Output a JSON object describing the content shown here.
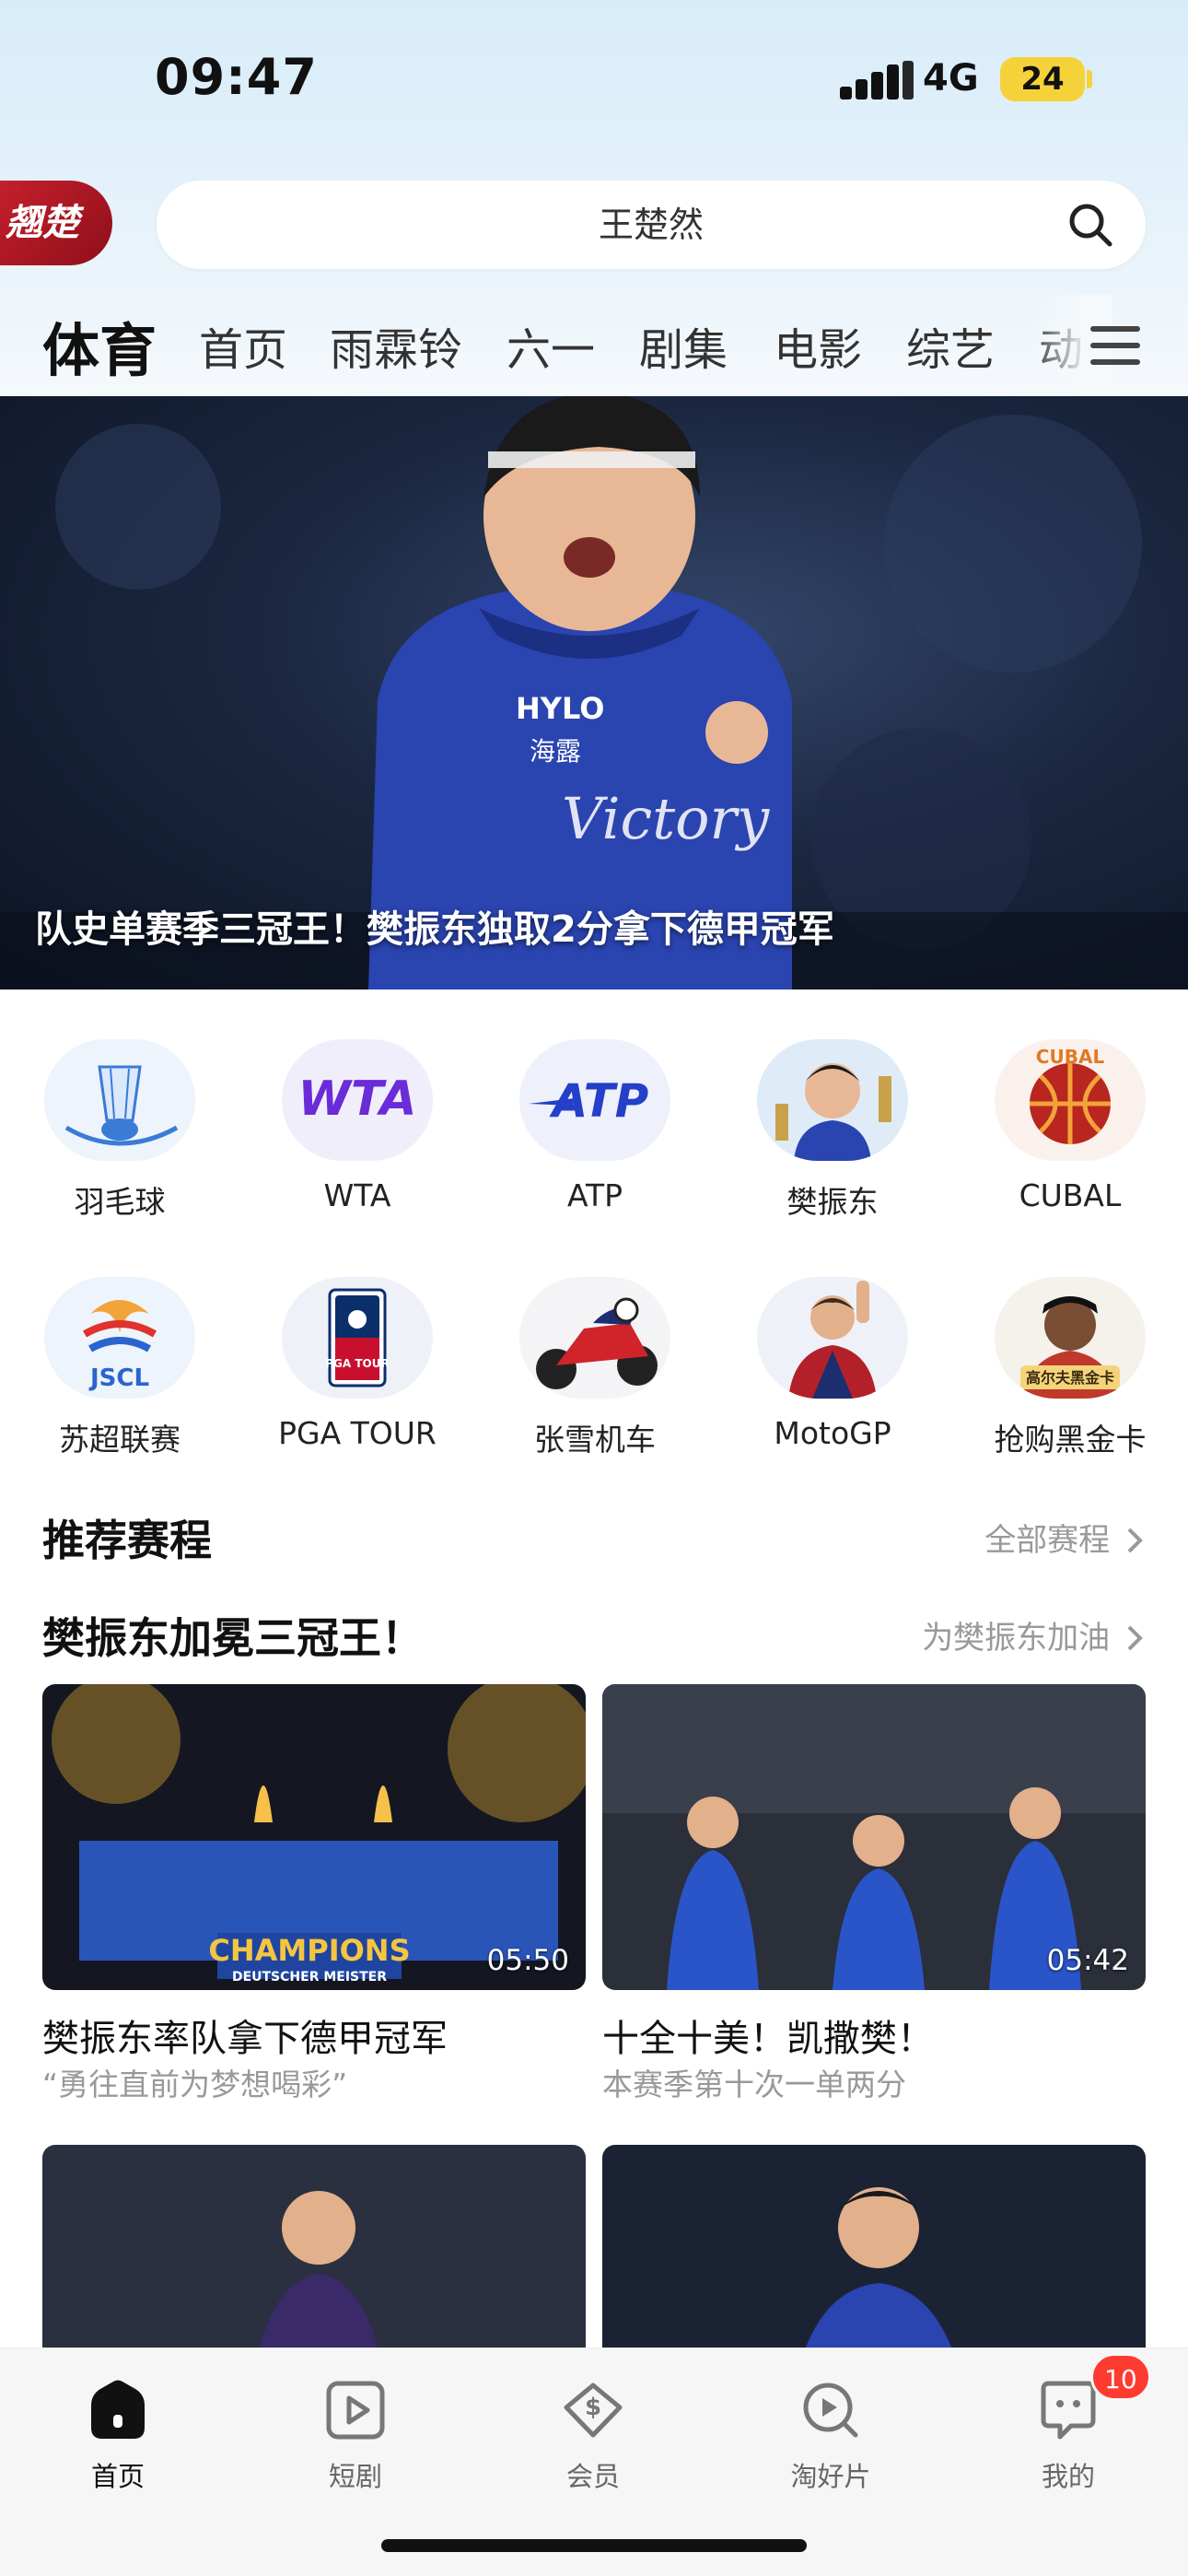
{
  "status_bar": {
    "time": "09:47",
    "network": "4G",
    "battery": "24"
  },
  "header": {
    "logo_text": "翘楚",
    "search": {
      "value": "王楚然"
    }
  },
  "channel_tabs": [
    "体育",
    "首页",
    "雨霖铃",
    "六一",
    "剧集",
    "电影",
    "综艺",
    "动"
  ],
  "hero": {
    "caption": "队史单赛季三冠王！樊振东独取2分拿下德甲冠军",
    "shirt_text": "HYLO 海露 Victory"
  },
  "categories": [
    {
      "label": "羽毛球",
      "icon": "shuttlecock-icon"
    },
    {
      "label": "WTA",
      "icon": "wta-logo"
    },
    {
      "label": "ATP",
      "icon": "atp-logo"
    },
    {
      "label": "樊振东",
      "icon": "player-avatar"
    },
    {
      "label": "CUBAL",
      "icon": "cubal-logo"
    },
    {
      "label": "苏超联赛",
      "icon": "jscl-logo"
    },
    {
      "label": "PGA TOUR",
      "icon": "pga-tour-logo"
    },
    {
      "label": "张雪机车",
      "icon": "motorbike-icon"
    },
    {
      "label": "MotoGP",
      "icon": "motogp-rider-avatar"
    },
    {
      "label": "抢购黑金卡",
      "icon": "golf-card-avatar",
      "badge": "高尔夫黑金卡"
    }
  ],
  "logo_texts": {
    "wta": "WTA",
    "atp": "ATP",
    "jscl": "JSCL",
    "pga": "PGA TOUR",
    "cubal": "CUBAL"
  },
  "schedule": {
    "title": "推荐赛程",
    "link": "全部赛程"
  },
  "featured": {
    "title": "樊振东加冕三冠王！",
    "link": "为樊振东加油"
  },
  "videos": [
    {
      "title": "樊振东率队拿下德甲冠军",
      "subtitle": "“勇往直前为梦想喝彩”",
      "duration": "05:50",
      "banner": "CHAMPIONS",
      "banner_sub": "DEUTSCHER MEISTER"
    },
    {
      "title": "十全十美！凯撒樊！",
      "subtitle": "本赛季第十次一单两分",
      "duration": "05:42"
    },
    {
      "title": "",
      "subtitle": "",
      "duration": ""
    },
    {
      "title": "",
      "subtitle": "",
      "duration": ""
    }
  ],
  "bottom_nav": [
    {
      "label": "首页",
      "icon": "home-icon",
      "active": true
    },
    {
      "label": "短剧",
      "icon": "play-icon"
    },
    {
      "label": "会员",
      "icon": "vip-diamond-icon"
    },
    {
      "label": "淘好片",
      "icon": "discover-icon"
    },
    {
      "label": "我的",
      "icon": "profile-icon"
    }
  ],
  "notification_badge": "10",
  "colors": {
    "accent_red": "#c51f2c",
    "badge_red": "#ff3b30",
    "battery_yellow": "#f6d23a",
    "jersey_blue": "#2a44b0"
  }
}
